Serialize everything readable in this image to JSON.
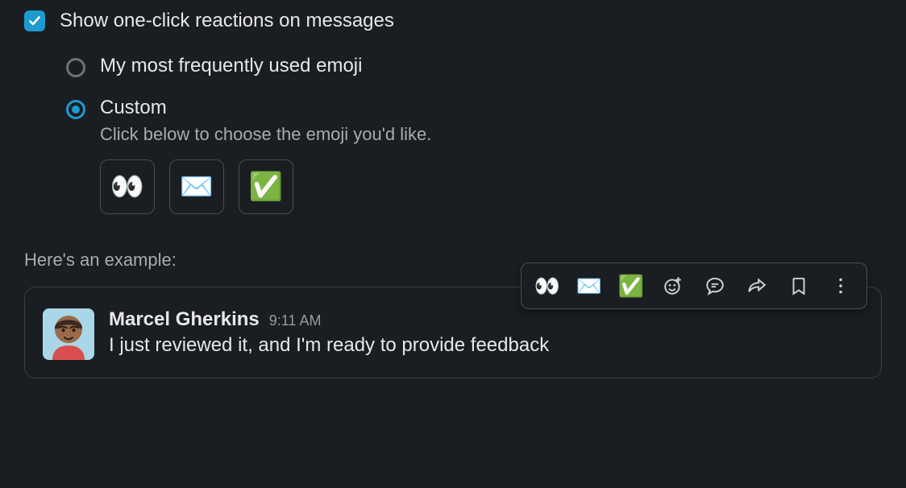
{
  "checkbox": {
    "label": "Show one-click reactions on messages",
    "checked": true
  },
  "radio_options": {
    "frequent": {
      "label": "My most frequently used emoji",
      "selected": false
    },
    "custom": {
      "label": "Custom",
      "selected": true,
      "description": "Click below to choose the emoji you'd like."
    }
  },
  "custom_emoji": {
    "slot1": "👀",
    "slot2": "✉️",
    "slot3": "✅"
  },
  "example": {
    "label": "Here's an example:",
    "sender": "Marcel Gherkins",
    "timestamp": "9:11 AM",
    "text": "I just reviewed it, and I'm ready to provide feedback"
  },
  "toolbar_emoji": {
    "e1": "👀",
    "e2": "✉️",
    "e3": "✅"
  }
}
